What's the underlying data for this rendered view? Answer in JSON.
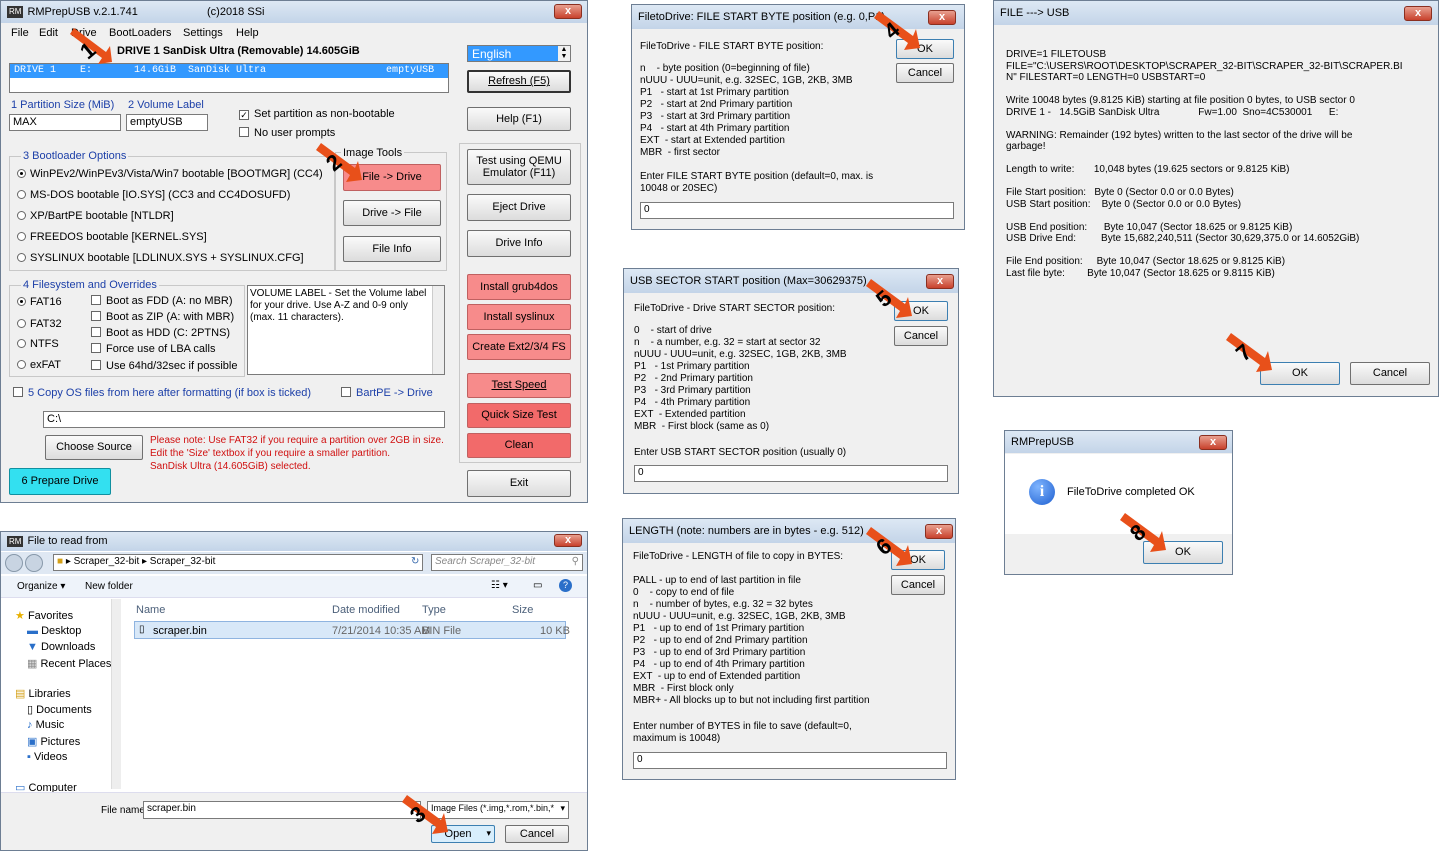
{
  "main": {
    "title": "RMPrepUSB v.2.1.741",
    "copyright": "(c)2018 SSi",
    "menu": [
      "File",
      "Edit",
      "Drive",
      "BootLoaders",
      "Settings",
      "Help"
    ],
    "drive_header": "DRIVE 1  SanDisk Ultra  (Removable) 14.605GiB",
    "drive_row": "DRIVE 1    E:       14.6GiB  SanDisk Ultra                    emptyUSB",
    "language": "English",
    "refresh": "Refresh (F5)",
    "help": "Help (F1)",
    "partition_size_label": "1 Partition Size (MiB)",
    "partition_size_value": "MAX",
    "volume_label_label": "2 Volume Label",
    "volume_label_value": "emptyUSB",
    "set_nonbootable": "Set partition as non-bootable",
    "no_prompts": "No user prompts",
    "bootloader_title": "3 Bootloader Options",
    "bootloaders": [
      "WinPEv2/WinPEv3/Vista/Win7 bootable [BOOTMGR] (CC4)",
      "MS-DOS bootable [IO.SYS]    (CC3 and CC4DOSUFD)",
      "XP/BartPE bootable [NTLDR]",
      "FREEDOS bootable [KERNEL.SYS]",
      "SYSLINUX bootable [LDLINUX.SYS + SYSLINUX.CFG]"
    ],
    "image_tools": "Image Tools",
    "file_to_drive": "File -> Drive",
    "drive_to_file": "Drive -> File",
    "file_info": "File Info",
    "qemu": "Test using QEMU Emulator (F11)",
    "eject": "Eject Drive",
    "drive_info": "Drive Info",
    "fs_title": "4 Filesystem and Overrides",
    "filesystems": [
      "FAT16",
      "FAT32",
      "NTFS",
      "exFAT"
    ],
    "overrides": [
      "Boot as FDD (A: no MBR)",
      "Boot as ZIP (A: with MBR)",
      "Boot as HDD (C: 2PTNS)",
      "Force use of LBA calls",
      "Use 64hd/32sec if possible"
    ],
    "volume_help": "VOLUME LABEL - Set the Volume label for your drive. Use A-Z and 0-9 only (max. 11 characters).",
    "install_grub": "Install grub4dos",
    "install_syslinux": "Install syslinux",
    "create_ext": "Create Ext2/3/4 FS",
    "copy_os": "5 Copy OS files from here after formatting (if box is ticked)",
    "bartpe": "BartPE -> Drive",
    "path": "C:\\",
    "choose_source": "Choose Source",
    "note1": "Please note: Use FAT32 if you require a partition over 2GB in size.",
    "note2": "Edit the 'Size' textbox if you require a smaller partition.",
    "note3": "SanDisk Ultra (14.605GiB) selected.",
    "prepare": "6 Prepare Drive",
    "test_speed": "Test Speed",
    "quick_size": "Quick Size Test",
    "clean": "Clean",
    "exit": "Exit"
  },
  "open_dialog": {
    "title": "File to read from",
    "path": [
      "Scraper_32-bit",
      "Scraper_32-bit"
    ],
    "search": "Search Scraper_32-bit",
    "organize": "Organize",
    "new_folder": "New folder",
    "nav": [
      "Favorites",
      "Desktop",
      "Downloads",
      "Recent Places",
      "Libraries",
      "Documents",
      "Music",
      "Pictures",
      "Videos",
      "Computer"
    ],
    "columns": [
      "Name",
      "Date modified",
      "Type",
      "Size"
    ],
    "file": {
      "name": "scraper.bin",
      "date": "7/21/2014 10:35 AM",
      "type": "BIN File",
      "size": "10 KB"
    },
    "filename_label": "File name:",
    "filename": "scraper.bin",
    "filter": "Image Files (*.img,*.rom,*.bin,*",
    "open": "Open",
    "cancel": "Cancel"
  },
  "start_byte": {
    "title": "FiletoDrive: FILE START BYTE position (e.g. 0,P1)",
    "heading": "FileToDrive - FILE START BYTE position:",
    "body": "n    - byte position (0=beginning of file)\nnUUU - UUU=unit, e.g. 32SEC, 1GB, 2KB, 3MB\nP1   - start at 1st Primary partition\nP2   - start at 2nd Primary partition\nP3   - start at 3rd Primary partition\nP4   - start at 4th Primary partition\nEXT  - start at Extended partition\nMBR  - first sector",
    "prompt": "Enter FILE START BYTE position (default=0, max. is\n10048 or 20SEC)",
    "value": "0",
    "ok": "OK",
    "cancel": "Cancel"
  },
  "usb_sector": {
    "title": "USB SECTOR START position (Max=30629375)",
    "heading": "FileToDrive - Drive START SECTOR position:",
    "body": "0    - start of drive\nn    - a number, e.g. 32 = start at sector 32\nnUUU - UUU=unit, e.g. 32SEC, 1GB, 2KB, 3MB\nP1   - 1st Primary partition\nP2   - 2nd Primary partition\nP3   - 3rd Primary partition\nP4   - 4th Primary partition\nEXT  - Extended partition\nMBR  - First block (same as 0)",
    "prompt": "Enter USB START SECTOR position (usually 0)",
    "value": "0",
    "ok": "OK",
    "cancel": "Cancel"
  },
  "length": {
    "title": "LENGTH (note: numbers are in bytes - e.g. 512)",
    "heading": "FileToDrive - LENGTH of file to copy in BYTES:",
    "body": "PALL - up to end of last partition in file\n0    - copy to end of file\nn    - number of bytes, e.g. 32 = 32 bytes\nnUUU - UUU=unit, e.g. 32SEC, 1GB, 2KB, 3MB\nP1   - up to end of 1st Primary partition\nP2   - up to end of 2nd Primary partition\nP3   - up to end of 3rd Primary partition\nP4   - up to end of 4th Primary partition\nEXT  - up to end of Extended partition\nMBR  - First block only\nMBR+ - All blocks up to but not including first partition",
    "prompt": "Enter number of BYTES in file to save (default=0,\nmaximum is 10048)",
    "value": "0",
    "ok": "OK",
    "cancel": "Cancel"
  },
  "summary": {
    "title": "FILE ---> USB",
    "body": "DRIVE=1 FILETOUSB\nFILE=\"C:\\USERS\\ROOT\\DESKTOP\\SCRAPER_32-BIT\\SCRAPER_32-BIT\\SCRAPER.BI\nN\" FILESTART=0 LENGTH=0 USBSTART=0\n\nWrite 10048 bytes (9.8125 KiB) starting at file position 0 bytes, to USB sector 0\nDRIVE 1 -   14.5GiB SanDisk Ultra              Fw=1.00  Sno=4C530001      E:\n\nWARNING: Remainder (192 bytes) written to the last sector of the drive will be\ngarbage!\n\nLength to write:       10,048 bytes (19.625 sectors or 9.8125 KiB)\n\nFile Start position:   Byte 0 (Sector 0.0 or 0.0 Bytes)\nUSB Start position:    Byte 0 (Sector 0.0 or 0.0 Bytes)\n\nUSB End position:      Byte 10,047 (Sector 18.625 or 9.8125 KiB)\nUSB Drive End:         Byte 15,682,240,511 (Sector 30,629,375.0 or 14.6052GiB)\n\nFile End position:     Byte 10,047 (Sector 18.625 or 9.8125 KiB)\nLast file byte:        Byte 10,047 (Sector 18.625 or 9.8115 KiB)",
    "ok": "OK",
    "cancel": "Cancel"
  },
  "done": {
    "title": "RMPrepUSB",
    "message": "FileToDrive completed OK",
    "ok": "OK"
  },
  "steps": [
    "1",
    "2",
    "3",
    "4",
    "5",
    "6",
    "7",
    "8"
  ],
  "colors": {
    "accent_red": "#f78b8b",
    "prepare": "#33e0f0",
    "arrow": "#e8501a"
  }
}
